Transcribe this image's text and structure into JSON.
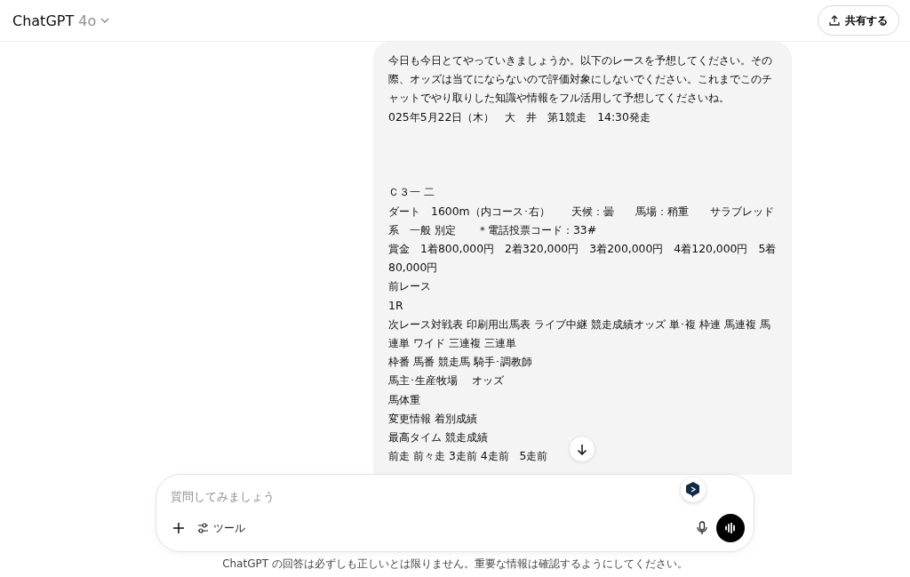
{
  "header": {
    "title": "ChatGPT",
    "model": "4o",
    "share_button": "共有する"
  },
  "message": {
    "lines": [
      {
        "kind": "text",
        "text": "今日も今日とてやっていきましょうか。以下のレースを予想してください。その際、オッズは当てにならないので評価対象にしないでください。これまでこのチャットでやり取りした知識や情報をフル活用して予想してくださいね。"
      },
      {
        "kind": "text",
        "text": "025年5月22日（木）　大　井　第1競走　14:30発走"
      },
      {
        "kind": "after_gap",
        "text": " Ｃ３一 二"
      },
      {
        "kind": "text",
        "text": "ダート　1600m（内コース･右）　　天候：曇　　馬場：稍重　　サラブレッド系　一般 別定　　＊電話投票コード：33#"
      },
      {
        "kind": "text",
        "text": "賞金　1着800,000円　2着320,000円　3着200,000円　4着120,000円　5着80,000円"
      },
      {
        "kind": "text",
        "text": "前レース"
      },
      {
        "kind": "text",
        "text": "1R"
      },
      {
        "kind": "text",
        "text": " 次レース対戦表 印刷用出馬表 ライブ中継 競走成績オッズ 単･複 枠連 馬連複 馬連単 ワイド 三連複 三連単"
      },
      {
        "kind": "text",
        "text": "枠番 馬番 競走馬 騎手･調教師"
      },
      {
        "kind": "text",
        "text": "馬主･生産牧場　 オッズ"
      },
      {
        "kind": "text",
        "text": "馬体重"
      },
      {
        "kind": "text",
        "text": "変更情報 着別成績"
      },
      {
        "kind": "text",
        "text": "最高タイム 競走成績"
      },
      {
        "kind": "text",
        "text": "前走 前々走 3走前 4走前　5走前"
      }
    ]
  },
  "composer": {
    "placeholder": "質問してみましょう",
    "tools_label": "ツール"
  },
  "disclaimer": "ChatGPT の回答は必ずしも正しいとは限りません。重要な情報は確認するようにしてください。"
}
